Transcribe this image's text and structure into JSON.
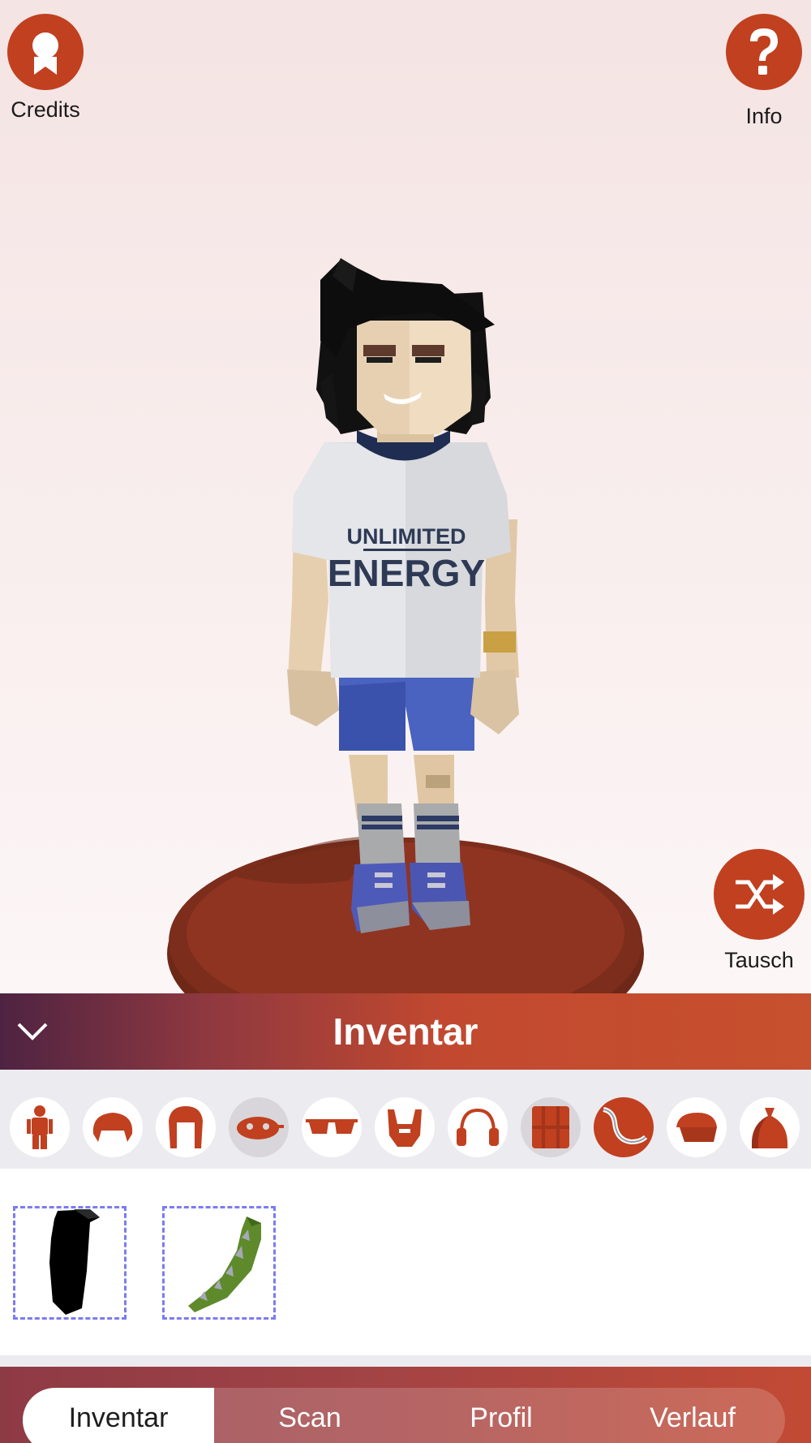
{
  "top_left": {
    "label": "Credits",
    "icon": "ribbon-badge-icon"
  },
  "top_right": {
    "label": "Info",
    "icon": "question-mark-icon"
  },
  "swap": {
    "label": "Tausch",
    "icon": "shuffle-icon"
  },
  "avatar": {
    "shirt_line1": "UNLIMITED",
    "shirt_line2": "ENERGY"
  },
  "inventory": {
    "title": "Inventar",
    "collapse_icon": "chevron-down-icon",
    "categories": [
      {
        "icon": "body-icon",
        "state": "normal"
      },
      {
        "icon": "short-hair-icon",
        "state": "normal"
      },
      {
        "icon": "long-hair-icon",
        "state": "normal"
      },
      {
        "icon": "mask-icon",
        "state": "dim"
      },
      {
        "icon": "glasses-icon",
        "state": "normal"
      },
      {
        "icon": "beard-icon",
        "state": "normal"
      },
      {
        "icon": "headphones-icon",
        "state": "normal"
      },
      {
        "icon": "vest-icon",
        "state": "dim"
      },
      {
        "icon": "tail-icon",
        "state": "selected"
      },
      {
        "icon": "cap-icon",
        "state": "normal"
      },
      {
        "icon": "bag-icon",
        "state": "normal"
      }
    ],
    "items": [
      {
        "icon": "black-cape-icon",
        "color": "#000000"
      },
      {
        "icon": "dragon-tail-icon",
        "color": "#5e8a2c"
      }
    ]
  },
  "nav": {
    "tabs": [
      {
        "label": "Inventar",
        "active": true
      },
      {
        "label": "Scan",
        "active": false
      },
      {
        "label": "Profil",
        "active": false
      },
      {
        "label": "Verlauf",
        "active": false
      }
    ]
  },
  "colors": {
    "accent": "#c0401f",
    "pedestal": "#8a3320",
    "slot_border": "#7a7cf0"
  }
}
